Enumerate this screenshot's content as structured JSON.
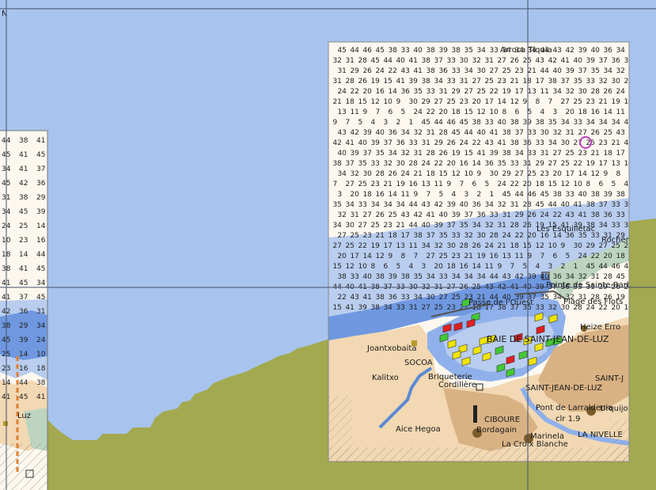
{
  "colors": {
    "sea": "#a8c4ee",
    "land": "#a3a94f",
    "chart_paper": "#fdf8ef",
    "shallow_water": "#6f98e0",
    "mid_water": "#b9cdef",
    "beach": "#f2d8b3",
    "urban": "#d9b284",
    "buoy_green": "#44c836",
    "buoy_red": "#e02020",
    "buoy_yellow": "#f0e400"
  },
  "labels": {
    "top_left_fragment": "N",
    "arroca": "Arroca Tiquia",
    "esquilletac": "Les Esquilletac",
    "rocher": "Rocher-Bel",
    "passe": "Passe de l'Ouest",
    "pointe": "Pointe de Sainte-Barbe",
    "plage": "Plage des Flots",
    "heize": "Heize Erro",
    "baie": "BAIE DE SAINT-JEAN-DE-LUZ",
    "joantxo": "Joantxobaita",
    "socoa": "SOCOA",
    "kalitxo": "Kalitxo",
    "briqueterie": "Briqueterie",
    "cordillere": "Cordillère",
    "saint_jean": "SAINT-JEAN-DE-LUZ",
    "saint_j2": "SAINT-J",
    "larralde": "Pont de Larraldenia",
    "urquijo": "Urquijo",
    "clr": "clr 1.9",
    "ciboure": "CIBOURE",
    "bordagain": "Bordagain",
    "aice": "Aice Hegoa",
    "marinela": "Marinela",
    "nivelle": "LA NIVELLE",
    "croix": "La Croix Blanche",
    "luz_left": "Luz"
  },
  "soundings_left": [
    "44",
    "38",
    "41",
    "45",
    "41",
    "45",
    "34",
    "41",
    "37",
    "45",
    "42",
    "36",
    "31",
    "38",
    "29",
    "34",
    "45",
    "39",
    "24",
    "25",
    "14",
    "10",
    "23",
    "16",
    "18",
    "14"
  ],
  "soundings_right": [
    "45",
    "44",
    "46",
    "45",
    "38",
    "33",
    "40",
    "38",
    "39",
    "38",
    "35",
    "34",
    "33",
    "34",
    "34",
    "34",
    "44",
    "43",
    "42",
    "39",
    "40",
    "36",
    "34",
    "32",
    "31",
    "28",
    "45",
    "44",
    "40",
    "41",
    "38",
    "37",
    "33",
    "30",
    "32",
    "31",
    "27",
    "26",
    "25",
    "43",
    "42",
    "41",
    "40",
    "39",
    "37",
    "36",
    "33",
    "31",
    "29",
    "26",
    "24",
    "22",
    "43",
    "41",
    "38",
    "36",
    "33",
    "34",
    "30",
    "27",
    "25",
    "23",
    "21",
    "44",
    "40",
    "39",
    "37",
    "35",
    "34",
    "32",
    "31",
    "28",
    "26",
    "19",
    "15",
    "41",
    "39",
    "38",
    "34",
    "33",
    "31",
    "27",
    "25",
    "23",
    "21",
    "18",
    "17",
    "38",
    "37",
    "35",
    "33",
    "32",
    "30",
    "28",
    "24",
    "22",
    "20",
    "16",
    "14",
    "36",
    "35",
    "33",
    "31",
    "29",
    "27",
    "25",
    "22",
    "19",
    "17",
    "13",
    "11",
    "34",
    "32",
    "30",
    "28",
    "26",
    "24",
    "21",
    "18",
    "15",
    "12",
    "10",
    "9",
    "30",
    "29",
    "27",
    "25",
    "23",
    "20",
    "17",
    "14",
    "12",
    "9",
    "8",
    "7",
    "27",
    "25",
    "23",
    "21",
    "19",
    "16",
    "13",
    "11",
    "9",
    "7",
    "6",
    "5",
    "24",
    "22",
    "20",
    "18",
    "15",
    "12",
    "10",
    "8",
    "6",
    "5",
    "4",
    "3",
    "20",
    "18",
    "16",
    "14",
    "11",
    "9",
    "7",
    "5",
    "4",
    "3",
    "2",
    "1"
  ]
}
